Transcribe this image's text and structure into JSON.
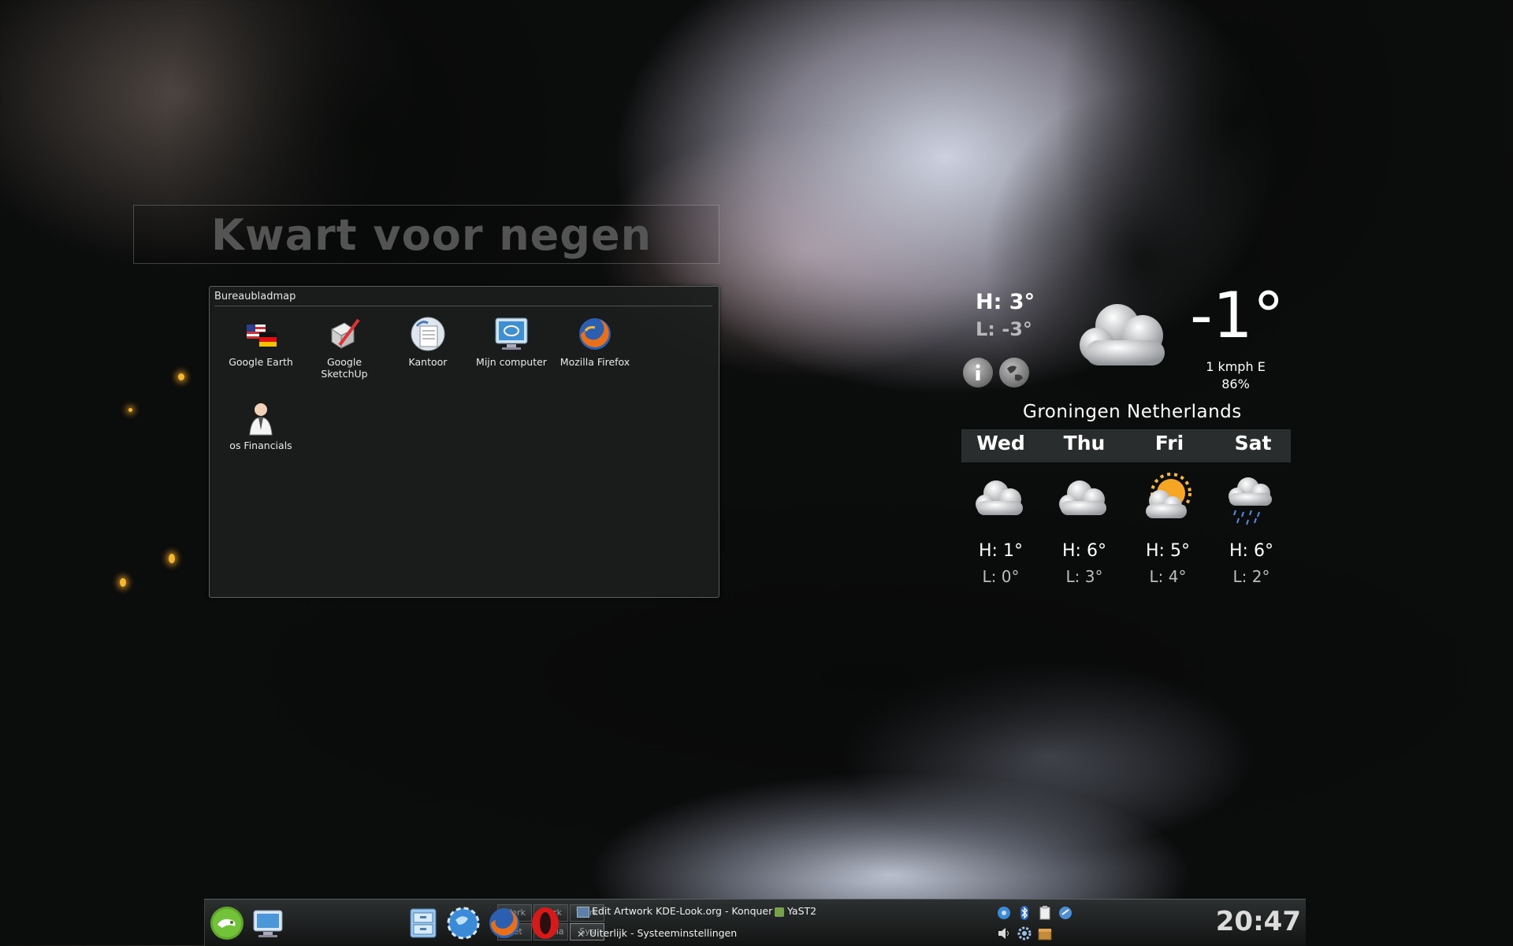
{
  "clock_widget": {
    "text": "Kwart voor negen"
  },
  "folder_view": {
    "title": "Bureaubladmap",
    "icons": [
      {
        "label": "Google Earth",
        "icon": "google-earth-icon"
      },
      {
        "label": "Google SketchUp",
        "icon": "google-sketchup-icon"
      },
      {
        "label": "Kantoor",
        "icon": "office-icon"
      },
      {
        "label": "Mijn computer",
        "icon": "computer-icon"
      },
      {
        "label": "Mozilla Firefox",
        "icon": "firefox-icon"
      },
      {
        "label": "os Financials",
        "icon": "financials-icon"
      }
    ]
  },
  "weather": {
    "high": "H: 3°",
    "low": "L: -3°",
    "temperature": "-1°",
    "wind": "1 kmph E",
    "humidity": "86%",
    "location": "Groningen  Netherlands",
    "forecast": [
      {
        "day": "Wed",
        "high": "H: 1°",
        "low": "L: 0°",
        "condition": "cloudy-icon"
      },
      {
        "day": "Thu",
        "high": "H: 6°",
        "low": "L: 3°",
        "condition": "cloudy-icon"
      },
      {
        "day": "Fri",
        "high": "H: 5°",
        "low": "L: 4°",
        "condition": "partly-sunny-icon"
      },
      {
        "day": "Sat",
        "high": "H: 6°",
        "low": "L: 2°",
        "condition": "rain-icon"
      }
    ]
  },
  "panel": {
    "pager": {
      "desktops": [
        "Werk",
        "Werk",
        "Werk",
        "Net",
        "Media",
        "Sys"
      ]
    },
    "tasks": [
      {
        "label": "Edit Artwork KDE-Look.org - Konquer"
      },
      {
        "label": "YaST2"
      },
      {
        "label": "Uiterlijk - Systeeminstellingen"
      }
    ],
    "clock": "20:47"
  }
}
